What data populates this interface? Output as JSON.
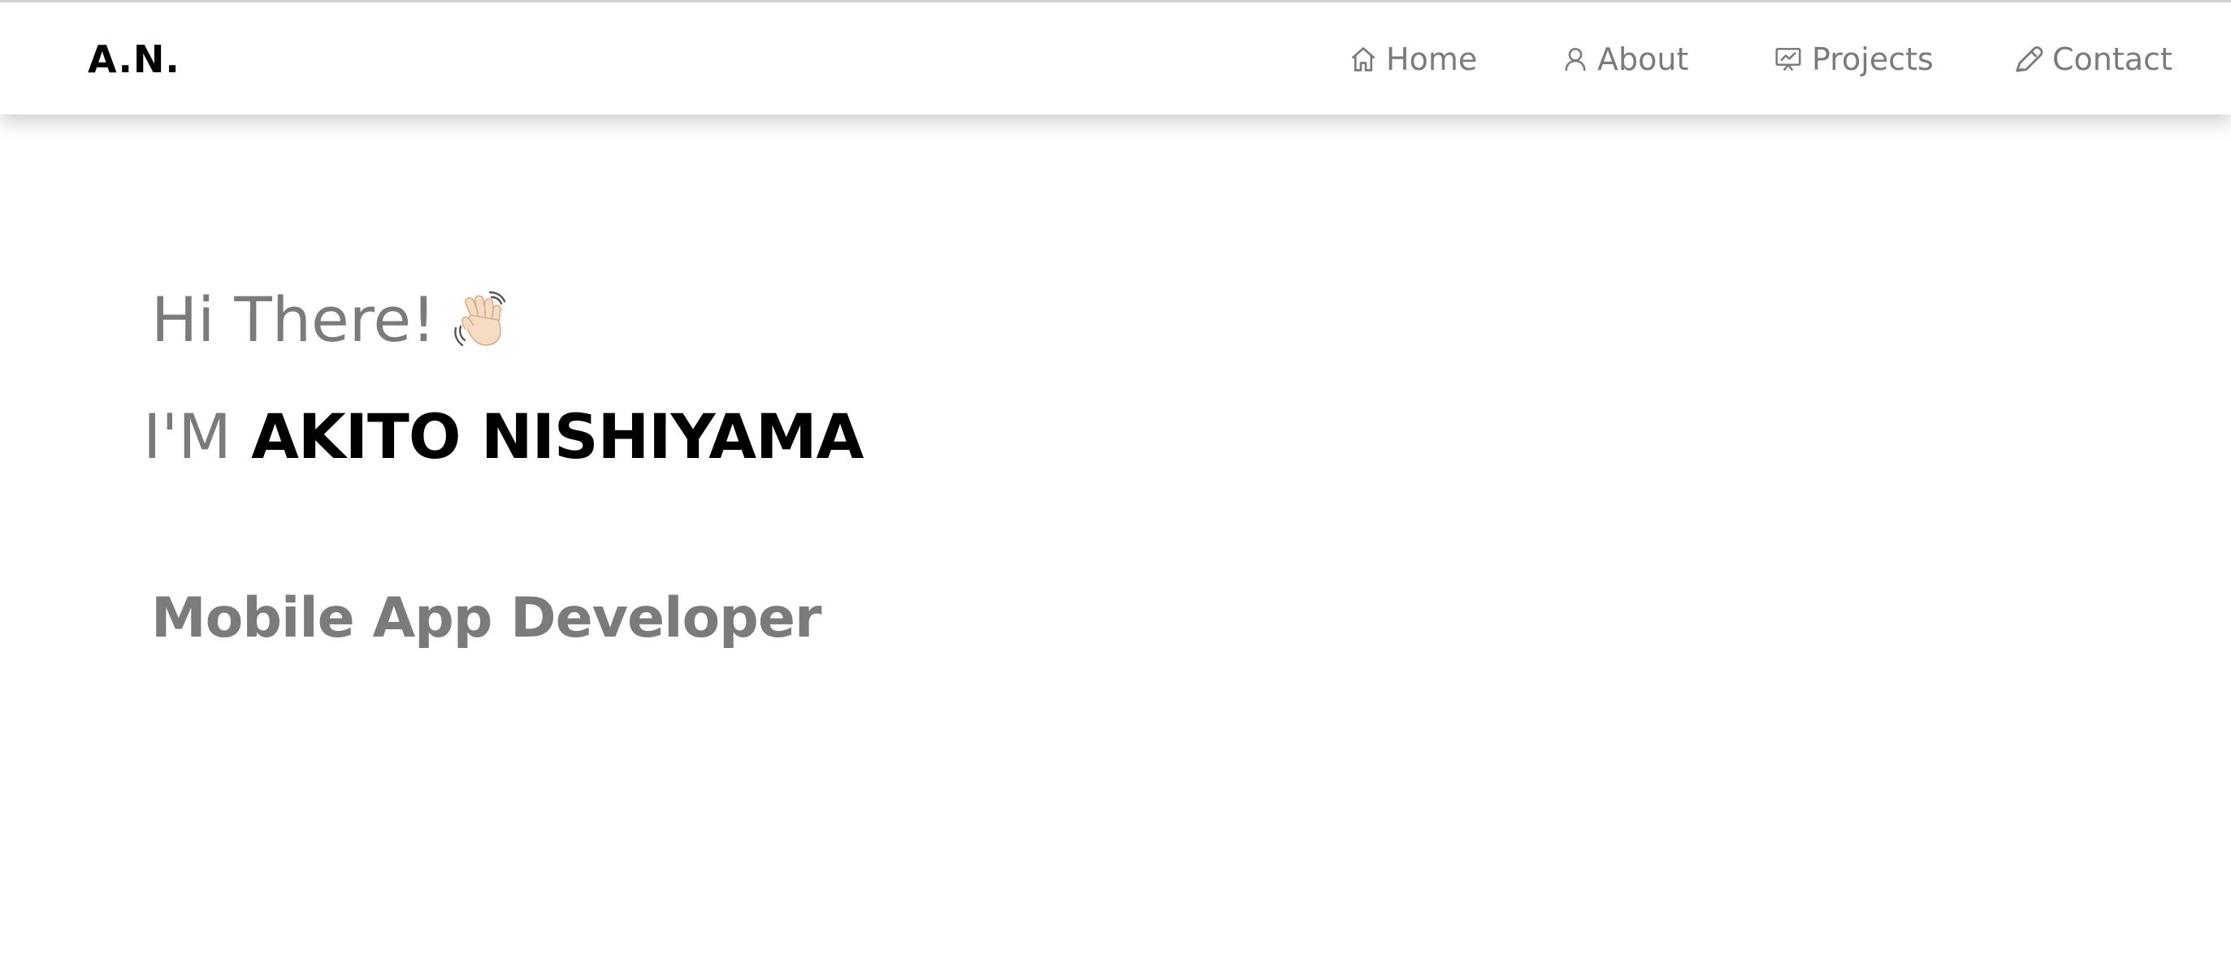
{
  "nav": {
    "brand": "A.N.",
    "items": [
      {
        "label": "Home",
        "icon": "home-icon"
      },
      {
        "label": "About",
        "icon": "user-icon"
      },
      {
        "label": "Projects",
        "icon": "presentation-chart-icon"
      },
      {
        "label": "Contact",
        "icon": "pen-icon"
      }
    ]
  },
  "hero": {
    "greeting": "Hi There!",
    "greeting_icon": "waving-hand-icon",
    "intro_prefix": "I'M",
    "name": "AKITO NISHIYAMA",
    "role": "Mobile App Developer"
  },
  "colors": {
    "text_muted": "#7b7b7b",
    "text_strong": "#000000",
    "background": "#ffffff"
  }
}
